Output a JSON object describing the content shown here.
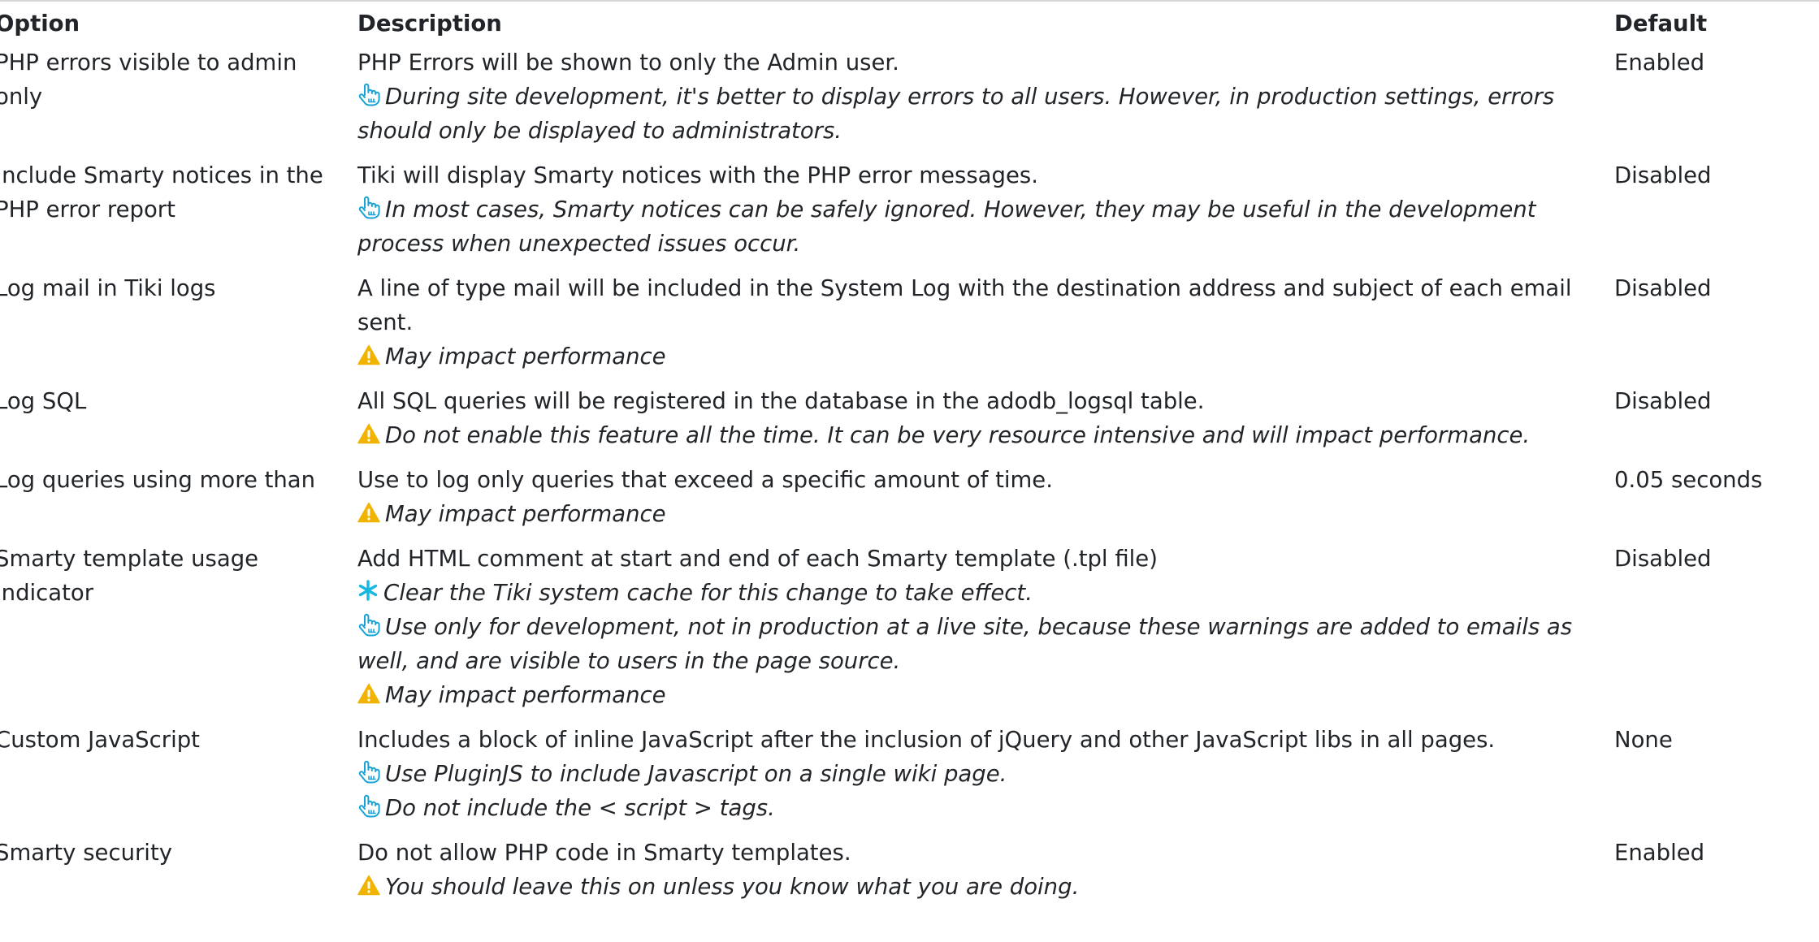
{
  "table": {
    "headers": {
      "option": "Option",
      "description": "Description",
      "default": "Default"
    },
    "rows": [
      {
        "option": "PHP errors visible to admin only",
        "description": "PHP Errors will be shown to only the Admin user.",
        "tip": "During site development, it's better to display errors to all users. However, in production settings, errors should only be displayed to administrators.",
        "default": "Enabled"
      },
      {
        "option": "Include Smarty notices in the PHP error report",
        "description": "Tiki will display Smarty notices with the PHP error messages.",
        "tip": "In most cases, Smarty notices can be safely ignored. However, they may be useful in the development process when unexpected issues occur.",
        "default": "Disabled"
      },
      {
        "option": "Log mail in Tiki logs",
        "description": "A line of type mail will be included in the System Log with the destination address and subject of each email sent.",
        "warning": "May impact performance",
        "default": "Disabled"
      },
      {
        "option": "Log SQL",
        "description": "All SQL queries will be registered in the database in the adodb_logsql table.",
        "warning": "Do not enable this feature all the time. It can be very resource intensive and will impact performance.",
        "default": "Disabled"
      },
      {
        "option": "Log queries using more than",
        "description": "Use to log only queries that exceed a specific amount of time.",
        "warning": "May impact performance",
        "default": "0.05 seconds"
      },
      {
        "option": "Smarty template usage indicator",
        "description": "Add HTML comment at start and end of each Smarty template (.tpl file)",
        "cache_note": "Clear the Tiki system cache for this change to take effect.",
        "tip": "Use only for development, not in production at a live site, because these warnings are added to emails as well, and are visible to users in the page source.",
        "warning": "May impact performance",
        "default": "Disabled"
      },
      {
        "option": "Custom JavaScript",
        "description": "Includes a block of inline JavaScript after the inclusion of jQuery and other JavaScript libs in all pages.",
        "tip": "Use PluginJS to include Javascript on a single wiki page.",
        "tip2": "Do not include the < script > tags.",
        "default": "None"
      },
      {
        "option": "Smarty security",
        "description": "Do not allow PHP code in Smarty templates.",
        "warning": "You should leave this on unless you know what you are doing.",
        "default": "Enabled"
      }
    ]
  },
  "icons": {
    "tip": "pointing-hand-icon",
    "warning": "warning-triangle-icon",
    "cache": "asterisk-icon"
  },
  "colors": {
    "tip_icon": "#17a2d8",
    "warning_icon": "#f0b400",
    "cache_icon": "#17b8e0",
    "text": "#212529"
  }
}
